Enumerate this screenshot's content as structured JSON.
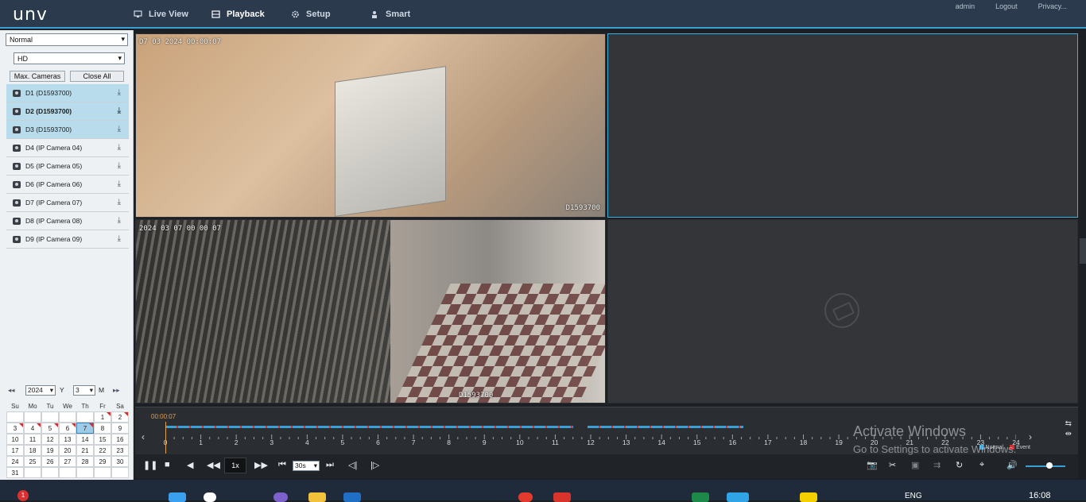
{
  "app": {
    "logo": "unv"
  },
  "nav": [
    {
      "label": "Live View",
      "icon": "monitor-icon",
      "active": false
    },
    {
      "label": "Playback",
      "icon": "film-icon",
      "active": true
    },
    {
      "label": "Setup",
      "icon": "gear-icon",
      "active": false
    },
    {
      "label": "Smart",
      "icon": "person-icon",
      "active": false
    }
  ],
  "toplinks": {
    "user": "admin",
    "logout": "Logout",
    "privacy": "Privacy..."
  },
  "left": {
    "mode_select": "Normal",
    "stream_select": "HD",
    "max_cameras_label": "Max. Cameras",
    "close_all_label": "Close All",
    "cameras": [
      {
        "label": "D1 (D1593700)",
        "selected": true,
        "bold": false
      },
      {
        "label": "D2 (D1593700)",
        "selected": true,
        "bold": true
      },
      {
        "label": "D3 (D1593700)",
        "selected": true,
        "bold": false
      },
      {
        "label": "D4 (IP Camera 04)",
        "selected": false,
        "bold": false
      },
      {
        "label": "D5 (IP Camera 05)",
        "selected": false,
        "bold": false
      },
      {
        "label": "D6 (IP Camera 06)",
        "selected": false,
        "bold": false
      },
      {
        "label": "D7 (IP Camera 07)",
        "selected": false,
        "bold": false
      },
      {
        "label": "D8 (IP Camera 08)",
        "selected": false,
        "bold": false
      },
      {
        "label": "D9 (IP Camera 09)",
        "selected": false,
        "bold": false
      }
    ]
  },
  "calendar": {
    "year": "2024",
    "year_label": "Y",
    "month": "3",
    "month_label": "M",
    "weekdays": [
      "Su",
      "Mo",
      "Tu",
      "We",
      "Th",
      "Fr",
      "Sa"
    ],
    "weeks": [
      [
        "",
        "",
        "",
        "",
        "",
        "1",
        "2"
      ],
      [
        "3",
        "4",
        "5",
        "6",
        "7",
        "8",
        "9"
      ],
      [
        "10",
        "11",
        "12",
        "13",
        "14",
        "15",
        "16"
      ],
      [
        "17",
        "18",
        "19",
        "20",
        "21",
        "22",
        "23"
      ],
      [
        "24",
        "25",
        "26",
        "27",
        "28",
        "29",
        "30"
      ],
      [
        "31",
        "",
        "",
        "",
        "",
        "",
        ""
      ]
    ],
    "flagged_days": [
      "1",
      "2",
      "3",
      "4",
      "5",
      "6",
      "7"
    ],
    "selected_day": "7"
  },
  "video": {
    "tile1_timestamp": "D7 03 2024 00:00:07",
    "tile1_name": "D1593700",
    "tile3_timestamp": "2024 03 07 00 00 07",
    "tile3_name": "D1593700"
  },
  "timeline": {
    "current_time": "00:00:07",
    "hours": [
      "0",
      "1",
      "2",
      "3",
      "4",
      "5",
      "6",
      "7",
      "8",
      "9",
      "10",
      "11",
      "12",
      "13",
      "14",
      "15",
      "16",
      "17",
      "18",
      "19",
      "20",
      "21",
      "22",
      "23",
      "24"
    ],
    "legend": [
      {
        "label": "Normal",
        "color": "#3aa0d4"
      },
      {
        "label": "Event",
        "color": "#d23030"
      }
    ],
    "record_segments": [
      {
        "start_hour": 0.0,
        "end_hour": 11.5
      },
      {
        "start_hour": 11.9,
        "end_hour": 16.3
      }
    ]
  },
  "controls": {
    "speed": "1x",
    "interval": "30s"
  },
  "watermark": {
    "line1": "Activate Windows",
    "line2": "Go to Settings to activate Windows."
  },
  "taskbar": {
    "notification_count": "1",
    "language": "ENG",
    "time": "16:08"
  },
  "colors": {
    "accent": "#3aa0d4",
    "topbar": "#2c3a4d",
    "event": "#d23030",
    "timecode": "#e0a050"
  }
}
